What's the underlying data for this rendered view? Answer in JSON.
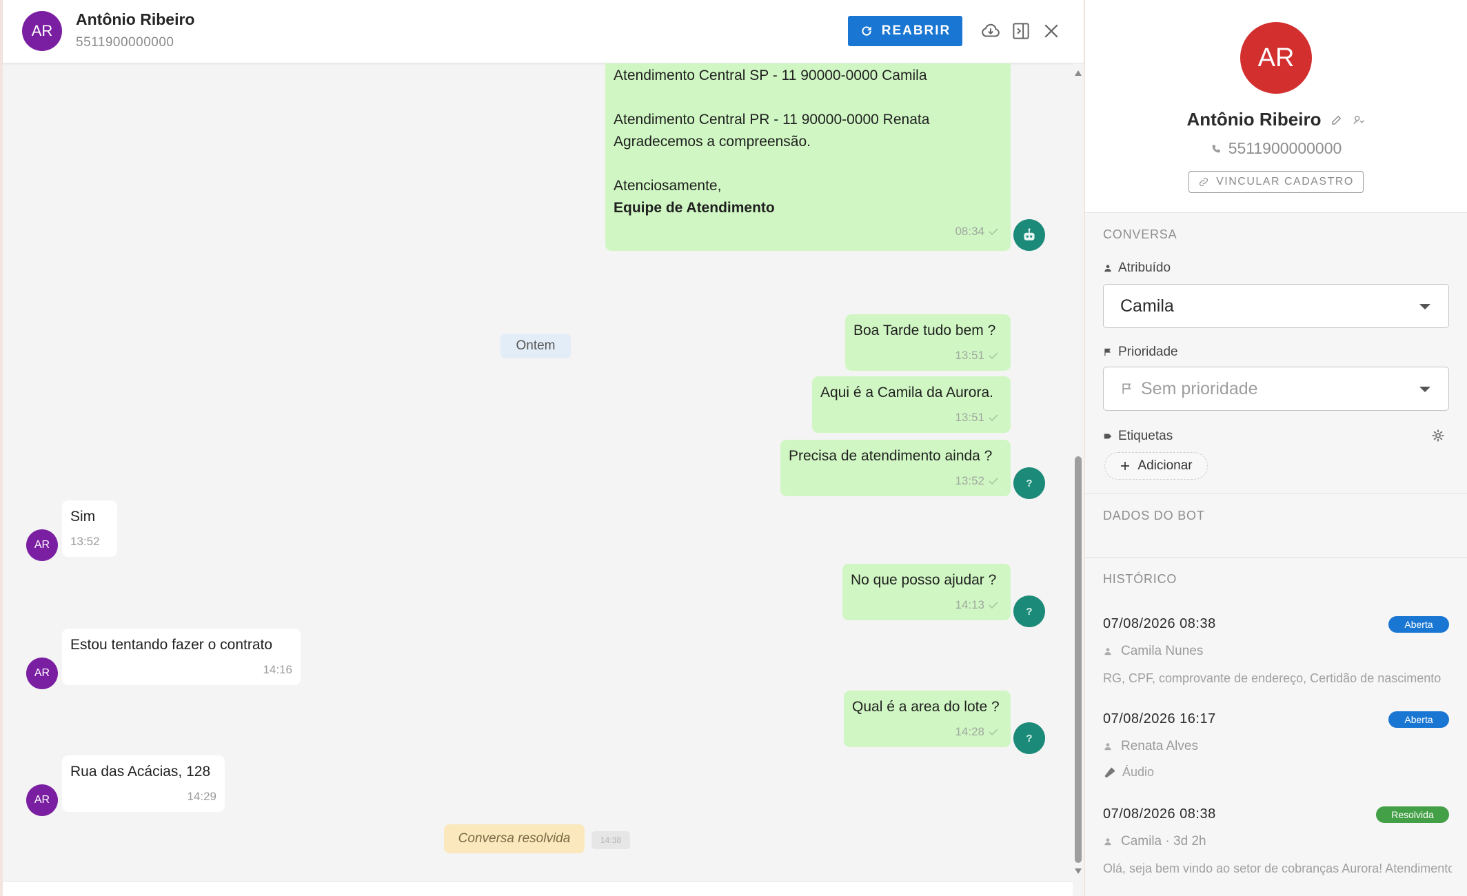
{
  "contact": {
    "initials": "AR",
    "name": "Antônio Ribeiro",
    "phone": "5511900000000",
    "avatar_color": "#7b1fa2",
    "profile_avatar_color": "#d32f2f"
  },
  "header": {
    "reopen_label": "REABRIR",
    "icons": [
      "refresh-icon",
      "cloud-download-icon",
      "panel-toggle-icon",
      "close-icon"
    ],
    "accent_color": "#1976d2"
  },
  "messages": {
    "first": {
      "line1": "Atendimento Central SP - 11 90000-0000 Camila",
      "line2": "Atendimento Central PR  - 11 90000-0000 Renata",
      "line3": "Agradecemos a compreensão.",
      "line4": "Atenciosamente,",
      "line5": "Equipe de Atendimento",
      "time": "08:34"
    },
    "date_separator": "Ontem",
    "out1": {
      "text": "Boa Tarde tudo bem ?",
      "time": "13:51"
    },
    "out2": {
      "text": "Aqui é a Camila da Aurora.",
      "time": "13:51"
    },
    "out3": {
      "text": "Precisa de atendimento ainda ?",
      "time": "13:52"
    },
    "in1": {
      "text": "Sim",
      "time": "13:52"
    },
    "out4": {
      "text": "No que posso ajudar ?",
      "time": "14:13"
    },
    "in2": {
      "text": "Estou tentando fazer o contrato",
      "time": "14:16"
    },
    "out5": {
      "text": "Qual é a area do lote ?",
      "time": "14:28"
    },
    "in3": {
      "text": "Rua das Acácias, 128",
      "time": "14:29"
    },
    "agent_badge": "?",
    "resolved_label": "Conversa resolvida",
    "resolved_time": "14:38",
    "outgoing_color": "#d0f7c3",
    "agent_badge_color": "#1b8a78"
  },
  "details": {
    "link_button": "VINCULAR CADASTRO",
    "conversation_title": "CONVERSA",
    "assigned_label": "Atribuído",
    "assigned_value": "Camila",
    "priority_label": "Prioridade",
    "priority_placeholder": "Sem prioridade",
    "tags_label": "Etiquetas",
    "add_tag_label": "Adicionar",
    "bot_data_title": "DADOS DO BOT",
    "history_title": "HISTÓRICO",
    "history": [
      {
        "date": "07/08/2026 08:38",
        "status": "Aberta",
        "user": "Camila Nunes",
        "preview": "RG, CPF, comprovante de endereço, Certidão de nascimento"
      },
      {
        "date": "07/08/2026 16:17",
        "status": "Aberta",
        "user": "Renata Alves",
        "preview": "Áudio"
      },
      {
        "date": "07/08/2026 08:38",
        "status": "Resolvida",
        "user": "Camila · 3d 2h",
        "preview": "Olá, seja bem vindo ao setor de cobranças Aurora! Atendimento"
      }
    ],
    "status_colors": {
      "Aberta": "#1976d2",
      "Resolvida": "#43a047"
    }
  }
}
